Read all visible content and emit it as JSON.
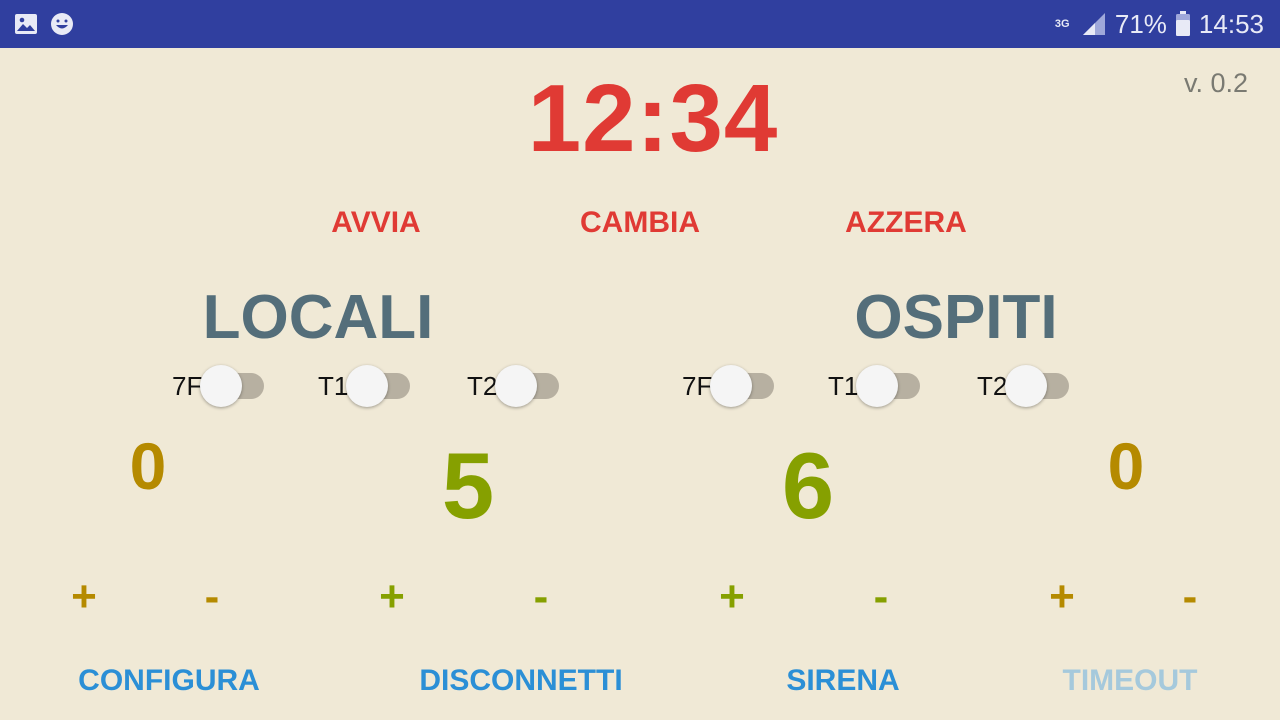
{
  "status_bar": {
    "network": "3G",
    "battery_percent": "71%",
    "time": "14:53",
    "left_icons": [
      "image-icon",
      "smiley-icon"
    ]
  },
  "version": "v. 0.2",
  "timer": "12:34",
  "controls": {
    "start": "AVVIA",
    "change": "CAMBIA",
    "reset": "AZZERA"
  },
  "teams": {
    "home": {
      "name": "LOCALI",
      "switches": [
        {
          "label": "7F",
          "on": false
        },
        {
          "label": "T1",
          "on": false
        },
        {
          "label": "T2",
          "on": false
        }
      ],
      "fouls": "0",
      "score": "5"
    },
    "away": {
      "name": "OSPITI",
      "switches": [
        {
          "label": "7F",
          "on": false
        },
        {
          "label": "T1",
          "on": false
        },
        {
          "label": "T2",
          "on": false
        }
      ],
      "fouls": "0",
      "score": "6"
    }
  },
  "adjust": {
    "plus": "+",
    "minus": "-"
  },
  "bottom_buttons": {
    "configure": "CONFIGURA",
    "disconnect": "DISCONNETTI",
    "siren": "SIRENA",
    "timeout": "TIMEOUT"
  },
  "colors": {
    "status_bar": "#303f9f",
    "background": "#f0e9d6",
    "timer": "#e03a34",
    "team_name": "#546e7a",
    "fouls": "#b58a00",
    "score": "#86a000",
    "action": "#2b8fd6",
    "action_disabled": "#a5c9dc"
  }
}
